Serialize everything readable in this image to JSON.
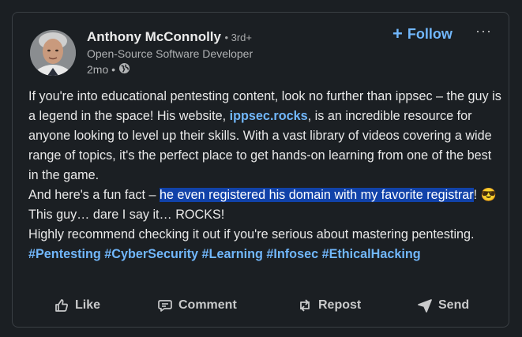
{
  "post": {
    "author": {
      "name": "Anthony McConnolly",
      "degree": "• 3rd+",
      "title": "Open-Source Software Developer",
      "time": "2mo •"
    },
    "follow_label": "Follow",
    "more_label": "···",
    "body": {
      "p1_start": "If you're into educational pentesting content, look no further than ippsec – the guy is a legend in the space! His website, ",
      "link": "ippsec.rocks",
      "p1_end": ", is an incredible resource for anyone looking to level up their skills. With a vast library of videos covering a wide range of topics, it's the perfect place to get hands-on learning from one of the best in the game.",
      "p2_start": "And here's a fun fact – ",
      "p2_highlight": "he even registered his domain with my favorite registrar",
      "p2_end": "! 😎 This guy… dare I say it… ROCKS!",
      "p3": "Highly recommend checking it out if you're serious about mastering pentesting."
    },
    "hashtags": [
      "#Pentesting",
      "#CyberSecurity",
      "#Learning",
      "#Infosec",
      "#EthicalHacking"
    ],
    "actions": {
      "like": "Like",
      "comment": "Comment",
      "repost": "Repost",
      "send": "Send"
    }
  },
  "colors": {
    "background": "#1b1f23",
    "link": "#71b7fb",
    "highlight": "#1142a9"
  },
  "icons": [
    "globe-icon",
    "plus-icon",
    "more-icon",
    "like-icon",
    "comment-icon",
    "repost-icon",
    "send-icon"
  ]
}
